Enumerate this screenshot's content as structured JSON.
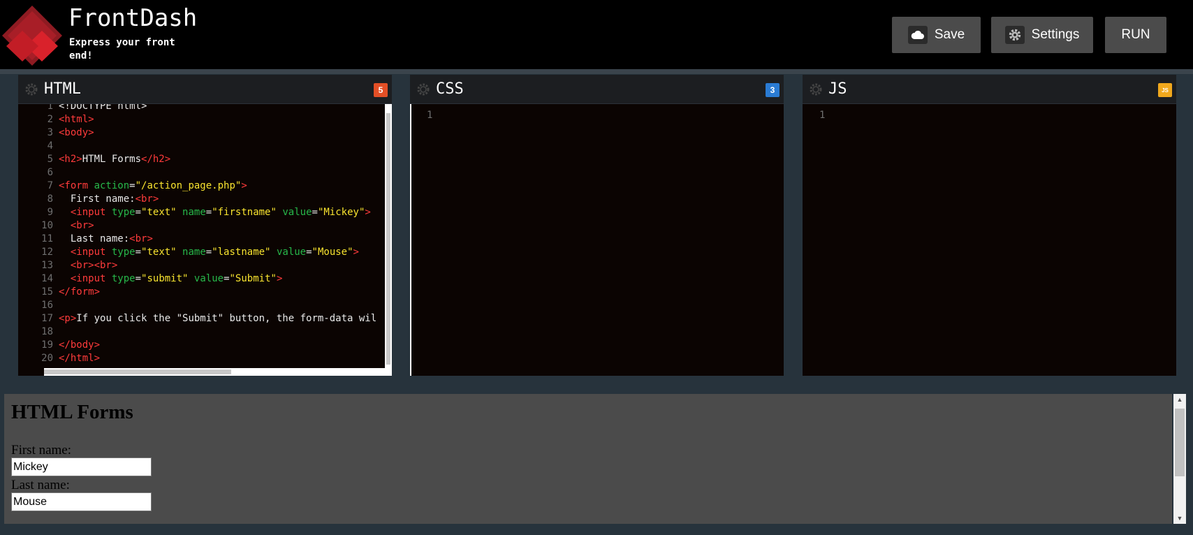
{
  "app": {
    "name": "FrontDash",
    "tagline": "Express your front end!"
  },
  "toolbar": {
    "save_label": "Save",
    "settings_label": "Settings",
    "run_label": "RUN"
  },
  "panels": {
    "html": {
      "title": "HTML",
      "badge": "5"
    },
    "css": {
      "title": "CSS",
      "badge": "3",
      "line_number": "1"
    },
    "js": {
      "title": "JS",
      "badge": "JS",
      "line_number": "1"
    }
  },
  "html_code": [
    {
      "n": "1",
      "parts": [
        [
          "txt",
          "<!DOCTYPE html>"
        ]
      ]
    },
    {
      "n": "2",
      "parts": [
        [
          "tag",
          "<html>"
        ]
      ]
    },
    {
      "n": "3",
      "parts": [
        [
          "tag",
          "<body>"
        ]
      ]
    },
    {
      "n": "4",
      "parts": []
    },
    {
      "n": "5",
      "parts": [
        [
          "tag",
          "<h2>"
        ],
        [
          "txt",
          "HTML Forms"
        ],
        [
          "tag",
          "</h2>"
        ]
      ]
    },
    {
      "n": "6",
      "parts": []
    },
    {
      "n": "7",
      "parts": [
        [
          "tag",
          "<form "
        ],
        [
          "attr",
          "action"
        ],
        [
          "txt",
          "="
        ],
        [
          "str",
          "\"/action_page.php\""
        ],
        [
          "tag",
          ">"
        ]
      ]
    },
    {
      "n": "8",
      "parts": [
        [
          "txt",
          "  First name:"
        ],
        [
          "tag",
          "<br>"
        ]
      ]
    },
    {
      "n": "9",
      "parts": [
        [
          "txt",
          "  "
        ],
        [
          "tag",
          "<input "
        ],
        [
          "attr",
          "type"
        ],
        [
          "txt",
          "="
        ],
        [
          "str",
          "\"text\""
        ],
        [
          "txt",
          " "
        ],
        [
          "attr",
          "name"
        ],
        [
          "txt",
          "="
        ],
        [
          "str",
          "\"firstname\""
        ],
        [
          "txt",
          " "
        ],
        [
          "attr",
          "value"
        ],
        [
          "txt",
          "="
        ],
        [
          "str",
          "\"Mickey\""
        ],
        [
          "tag",
          ">"
        ]
      ]
    },
    {
      "n": "10",
      "parts": [
        [
          "txt",
          "  "
        ],
        [
          "tag",
          "<br>"
        ]
      ]
    },
    {
      "n": "11",
      "parts": [
        [
          "txt",
          "  Last name:"
        ],
        [
          "tag",
          "<br>"
        ]
      ]
    },
    {
      "n": "12",
      "parts": [
        [
          "txt",
          "  "
        ],
        [
          "tag",
          "<input "
        ],
        [
          "attr",
          "type"
        ],
        [
          "txt",
          "="
        ],
        [
          "str",
          "\"text\""
        ],
        [
          "txt",
          " "
        ],
        [
          "attr",
          "name"
        ],
        [
          "txt",
          "="
        ],
        [
          "str",
          "\"lastname\""
        ],
        [
          "txt",
          " "
        ],
        [
          "attr",
          "value"
        ],
        [
          "txt",
          "="
        ],
        [
          "str",
          "\"Mouse\""
        ],
        [
          "tag",
          ">"
        ]
      ]
    },
    {
      "n": "13",
      "parts": [
        [
          "txt",
          "  "
        ],
        [
          "tag",
          "<br><br>"
        ]
      ]
    },
    {
      "n": "14",
      "parts": [
        [
          "txt",
          "  "
        ],
        [
          "tag",
          "<input "
        ],
        [
          "attr",
          "type"
        ],
        [
          "txt",
          "="
        ],
        [
          "str",
          "\"submit\""
        ],
        [
          "txt",
          " "
        ],
        [
          "attr",
          "value"
        ],
        [
          "txt",
          "="
        ],
        [
          "str",
          "\"Submit\""
        ],
        [
          "tag",
          ">"
        ]
      ]
    },
    {
      "n": "15",
      "parts": [
        [
          "tag",
          "</form>"
        ]
      ]
    },
    {
      "n": "16",
      "parts": []
    },
    {
      "n": "17",
      "parts": [
        [
          "tag",
          "<p>"
        ],
        [
          "txt",
          "If you click the \"Submit\" button, the form-data wil"
        ]
      ]
    },
    {
      "n": "18",
      "parts": []
    },
    {
      "n": "19",
      "parts": [
        [
          "tag",
          "</body>"
        ]
      ]
    },
    {
      "n": "20",
      "parts": [
        [
          "tag",
          "</html>"
        ]
      ]
    }
  ],
  "preview": {
    "heading": "HTML Forms",
    "first_label": "First name:",
    "first_value": "Mickey",
    "last_label": "Last name:",
    "last_value": "Mouse"
  },
  "colors": {
    "tag": "#ff3b3b",
    "attr": "#27b84a",
    "string": "#f8e32f",
    "logo": "#c8202b"
  }
}
